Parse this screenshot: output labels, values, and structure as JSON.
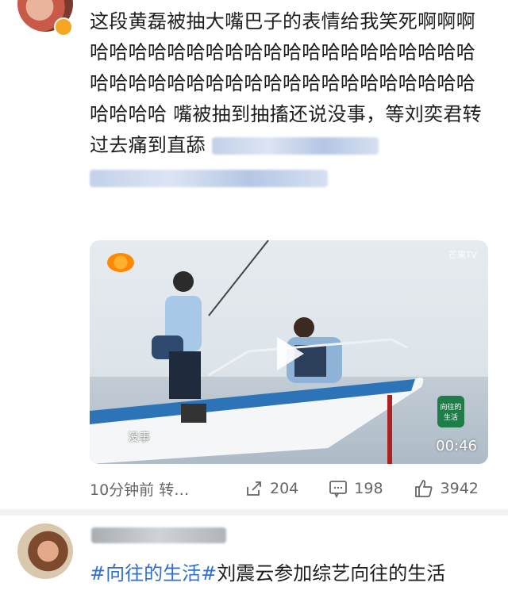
{
  "post": {
    "text_main": "这段黄磊被抽大嘴巴子的表情给我笑死啊啊啊哈哈哈哈哈哈哈哈哈哈哈哈哈哈哈哈哈哈哈哈哈哈哈哈哈哈哈哈哈哈哈哈哈哈哈哈哈哈哈哈哈哈哈哈 嘴被抽到抽搐还说没事，等刘奕君转过去痛到直舔",
    "video": {
      "subtitle": "没事",
      "duration": "00:46",
      "corner_tag": "芒果TV",
      "show_badge": "向往的生活"
    },
    "meta": {
      "time": "10分钟前 转…",
      "share_count": "204",
      "comment_count": "198",
      "like_count": "3942"
    }
  },
  "post2": {
    "hashtag": "#向往的生活#",
    "text": "刘震云参加综艺向往的生活"
  },
  "colors": {
    "link_blue": "#2f6fd1",
    "text": "#1d1d1d",
    "meta_gray": "#666666"
  }
}
